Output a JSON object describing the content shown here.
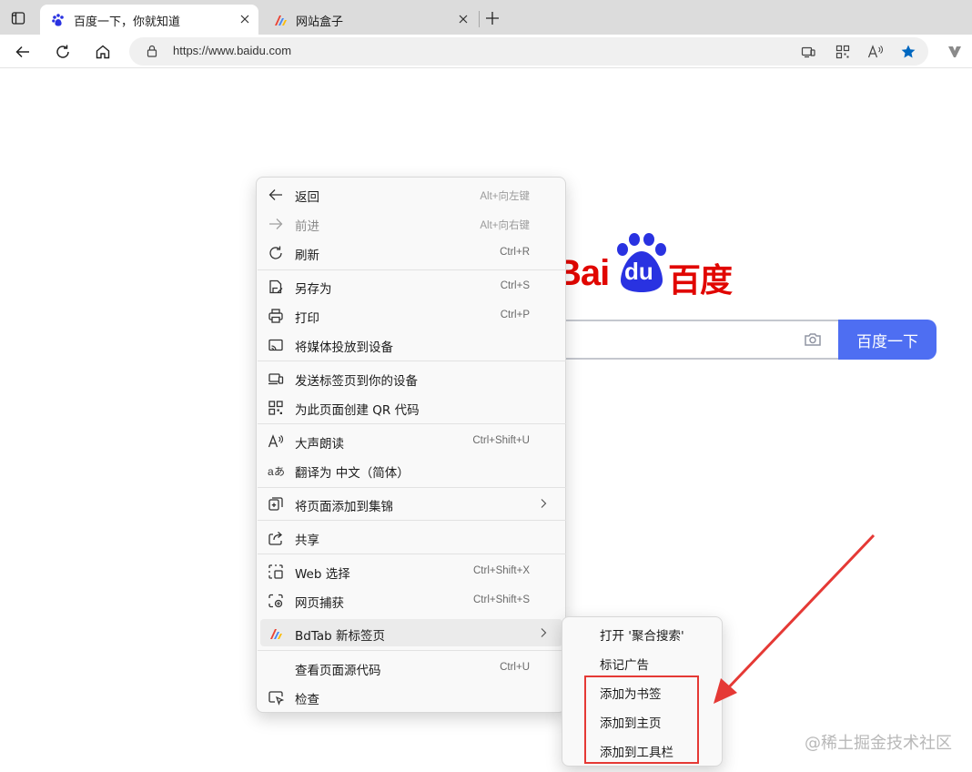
{
  "browser": {
    "tabs": [
      {
        "title": "百度一下，你就知道",
        "active": true,
        "favicon": "baidu-paw-icon"
      },
      {
        "title": "网站盒子",
        "active": false,
        "favicon": "bdtab-icon"
      }
    ],
    "url": "https://www.baidu.com",
    "accent_color": "#0067c0"
  },
  "page": {
    "logo_latin": "Bai",
    "logo_du": "du",
    "logo_cn": "百度",
    "search_button": "百度一下",
    "brand_blue": "#4e6ef2",
    "brand_red": "#e10601"
  },
  "context_menu": {
    "items": [
      {
        "label": "返回",
        "shortcut": "Alt+向左键",
        "icon": "back-arrow-icon"
      },
      {
        "label": "前进",
        "shortcut": "Alt+向右键",
        "icon": "forward-arrow-icon",
        "disabled": true
      },
      {
        "label": "刷新",
        "shortcut": "Ctrl+R",
        "icon": "refresh-icon"
      },
      {
        "label": "另存为",
        "shortcut": "Ctrl+S",
        "icon": "save-as-icon"
      },
      {
        "label": "打印",
        "shortcut": "Ctrl+P",
        "icon": "printer-icon"
      },
      {
        "label": "将媒体投放到设备",
        "shortcut": "",
        "icon": "cast-icon"
      },
      {
        "label": "发送标签页到你的设备",
        "shortcut": "",
        "icon": "send-device-icon"
      },
      {
        "label": "为此页面创建 QR 代码",
        "shortcut": "",
        "icon": "qr-code-icon"
      },
      {
        "label": "大声朗读",
        "shortcut": "Ctrl+Shift+U",
        "icon": "read-aloud-icon"
      },
      {
        "label": "翻译为 中文（简体）",
        "shortcut": "",
        "icon": "translate-icon"
      },
      {
        "label": "将页面添加到集锦",
        "shortcut": "",
        "icon": "collections-icon",
        "submenu": true
      },
      {
        "label": "共享",
        "shortcut": "",
        "icon": "share-icon"
      },
      {
        "label": "Web 选择",
        "shortcut": "Ctrl+Shift+X",
        "icon": "web-select-icon"
      },
      {
        "label": "网页捕获",
        "shortcut": "Ctrl+Shift+S",
        "icon": "web-capture-icon"
      },
      {
        "label": "BdTab 新标签页",
        "shortcut": "",
        "icon": "bdtab-icon",
        "submenu": true,
        "highlighted": true
      },
      {
        "label": "查看页面源代码",
        "shortcut": "Ctrl+U",
        "icon": ""
      },
      {
        "label": "检查",
        "shortcut": "",
        "icon": "inspect-icon"
      }
    ]
  },
  "submenu": {
    "items": [
      {
        "label": "打开 '聚合搜索'"
      },
      {
        "label": "标记广告"
      },
      {
        "label": "添加为书签"
      },
      {
        "label": "添加到主页"
      },
      {
        "label": "添加到工具栏"
      }
    ]
  },
  "annotation_color": "#e53935",
  "watermark": "@稀土掘金技术社区"
}
